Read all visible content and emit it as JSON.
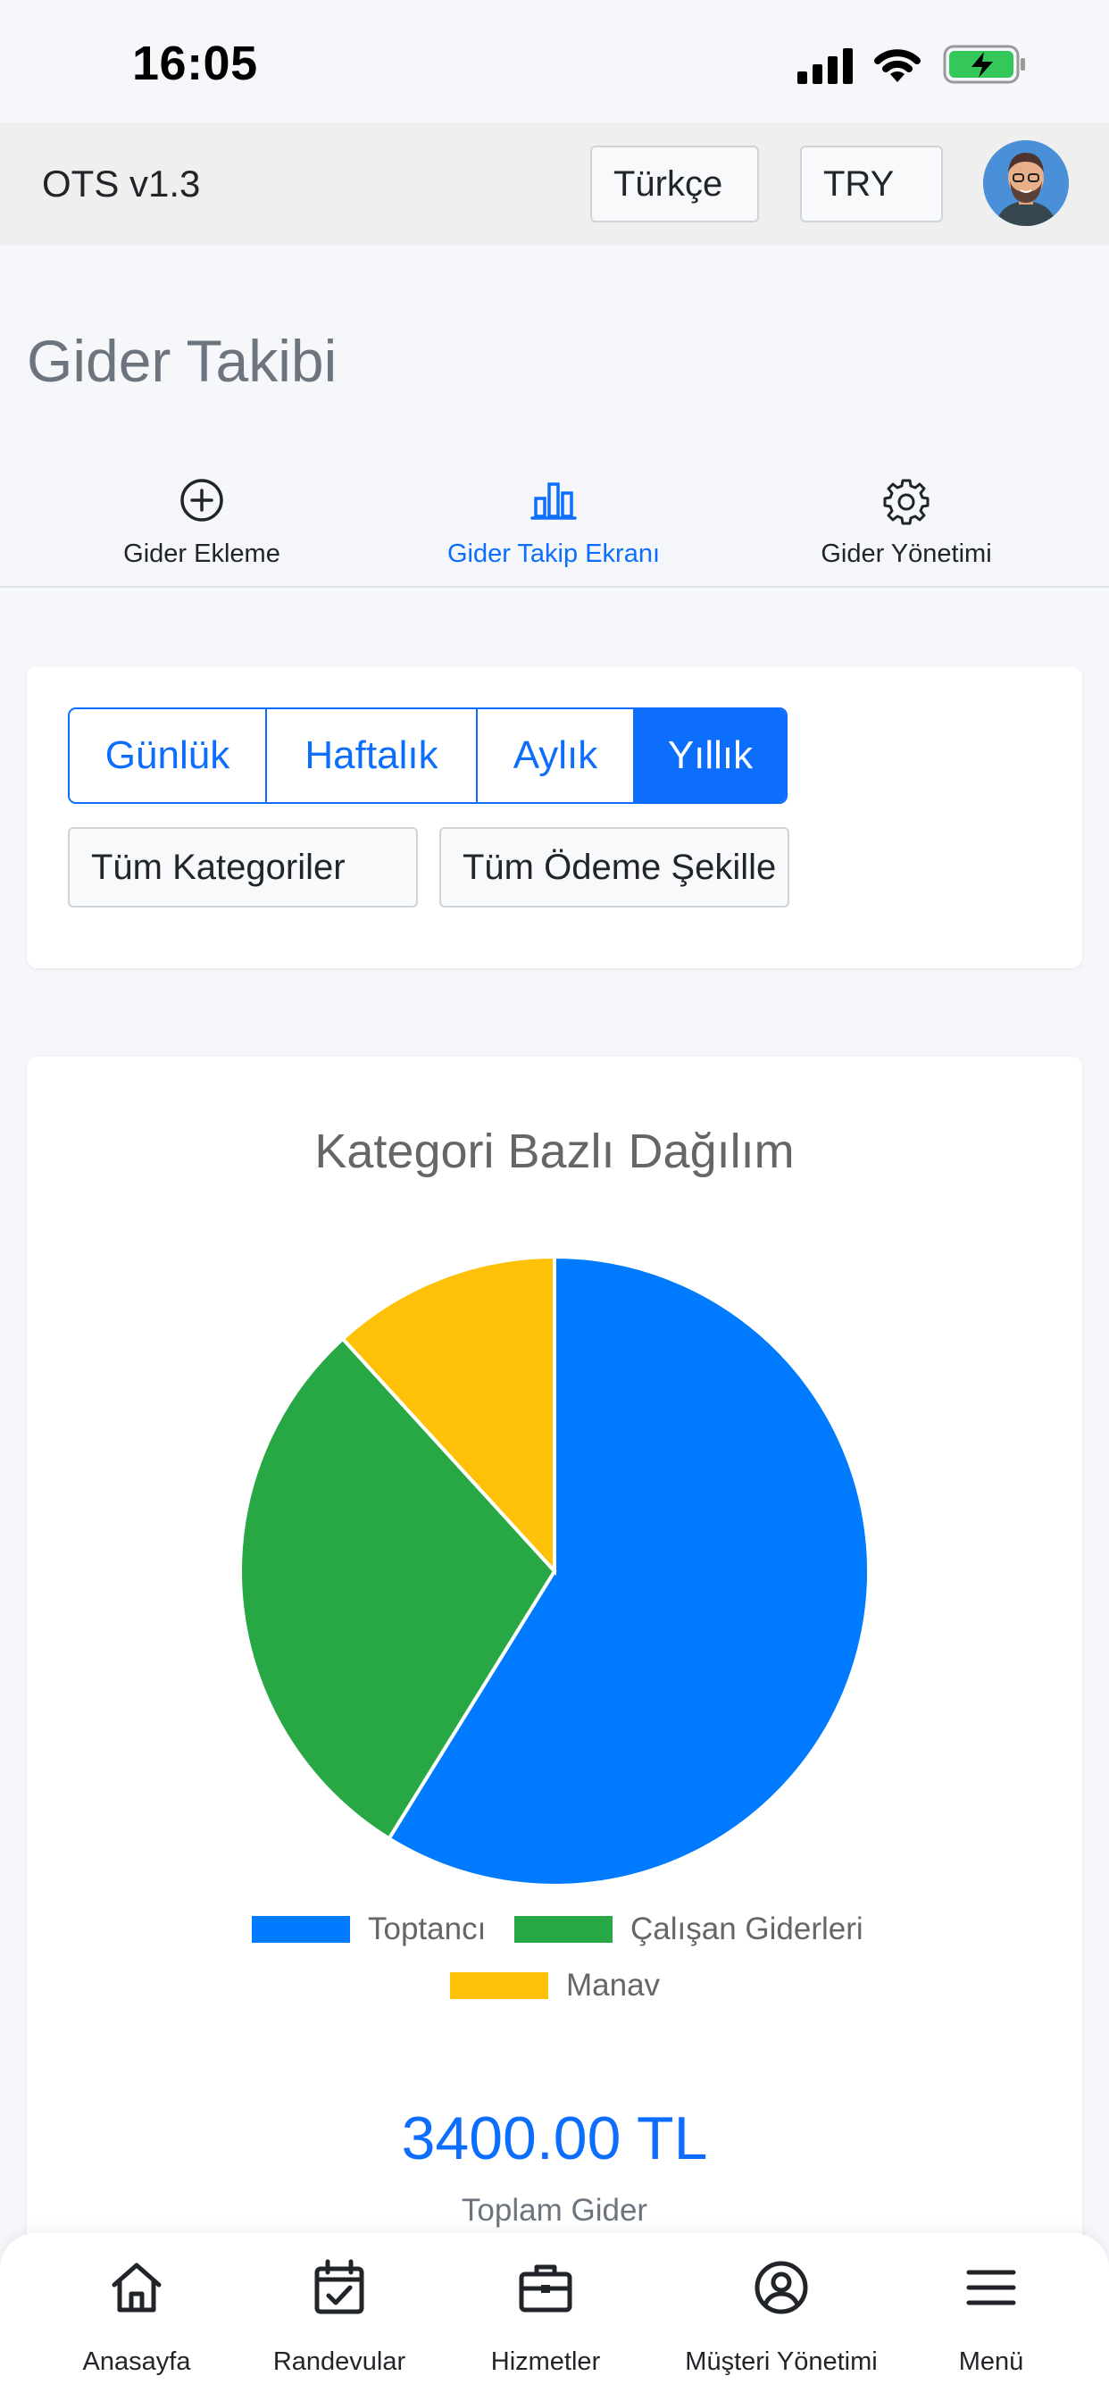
{
  "status_bar": {
    "time": "16:05"
  },
  "header": {
    "app_title": "OTS v1.3",
    "language": "Türkçe",
    "currency": "TRY"
  },
  "page": {
    "title": "Gider Takibi"
  },
  "tabs": [
    {
      "label": "Gider Ekleme",
      "icon": "plus-circle-icon",
      "active": false
    },
    {
      "label": "Gider Takip Ekranı",
      "icon": "bar-chart-icon",
      "active": true
    },
    {
      "label": "Gider Yönetimi",
      "icon": "gear-icon",
      "active": false
    }
  ],
  "filters": {
    "periods": [
      "Günlük",
      "Haftalık",
      "Aylık",
      "Yıllık"
    ],
    "active_period": "Yıllık",
    "category": "Tüm Kategoriler",
    "payment_method": "Tüm Ödeme Şekille"
  },
  "colors": {
    "accent": "#0d6efd",
    "series_blue": "#007bff",
    "series_green": "#28a745",
    "series_yellow": "#ffc107"
  },
  "chart_data": {
    "type": "pie",
    "title": "Kategori Bazlı Dağılım",
    "categories": [
      "Toptancı",
      "Çalışan Giderleri",
      "Manav"
    ],
    "values": [
      2000,
      1000,
      400
    ],
    "colors": [
      "#007bff",
      "#28a745",
      "#ffc107"
    ],
    "legend_position": "bottom"
  },
  "summary": {
    "total": "3400.00 TL",
    "total_label": "Toplam Gider"
  },
  "bottom_nav": [
    {
      "label": "Anasayfa",
      "icon": "home-icon"
    },
    {
      "label": "Randevular",
      "icon": "calendar-check-icon"
    },
    {
      "label": "Hizmetler",
      "icon": "briefcase-icon"
    },
    {
      "label": "Müşteri Yönetimi",
      "icon": "user-circle-icon"
    },
    {
      "label": "Menü",
      "icon": "menu-icon"
    }
  ]
}
